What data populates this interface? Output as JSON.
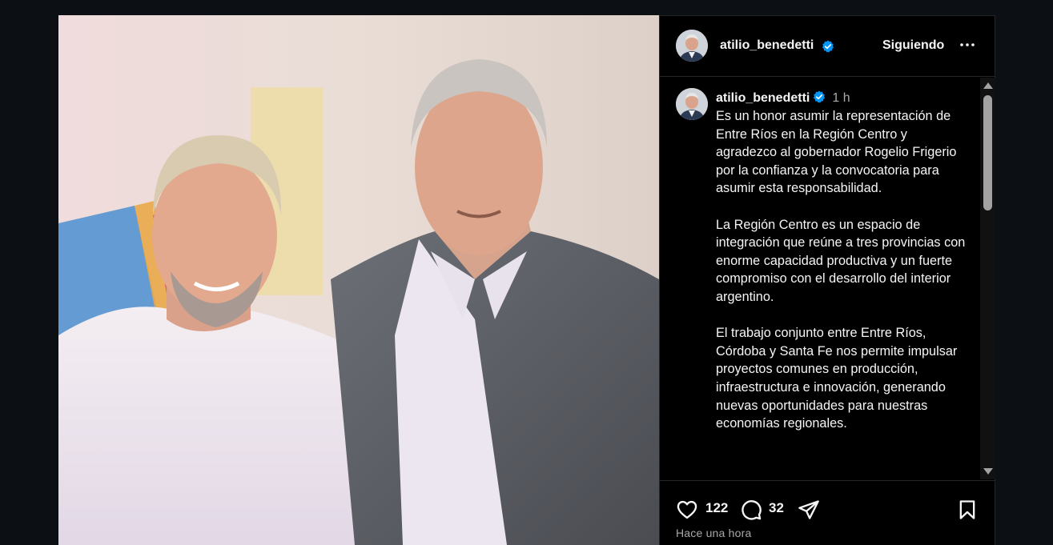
{
  "post": {
    "username": "atilio_benedetti",
    "follow_label": "Siguiendo",
    "more_icon": "more-horizontal-icon",
    "verified_icon": "verified-badge-icon"
  },
  "caption": {
    "username": "atilio_benedetti",
    "time": "1 h",
    "text": "Es un honor asumir la representación de Entre Ríos en la Región Centro y agradezco al gobernador Rogelio Frigerio por la confianza y la convocatoria para asumir esta responsabilidad.\n\nLa Región Centro es un espacio de integración que reúne a tres provincias con enorme capacidad productiva y un fuerte compromiso con el desarrollo del interior argentino.\n\nEl trabajo conjunto entre Entre Ríos, Córdoba y Santa Fe nos permite impulsar proyectos comunes en producción, infraestructura e innovación, generando nuevas oportunidades para nuestras economías regionales."
  },
  "actions": {
    "likes": "122",
    "comments": "32",
    "time_ago": "Hace una hora",
    "icons": [
      "heart-icon",
      "comment-icon",
      "share-icon",
      "bookmark-icon"
    ]
  },
  "colors": {
    "background": "#0c1014",
    "panel": "#000000",
    "verified": "#0095f6",
    "text": "#f5f5f5",
    "muted": "#a8a8a8"
  }
}
